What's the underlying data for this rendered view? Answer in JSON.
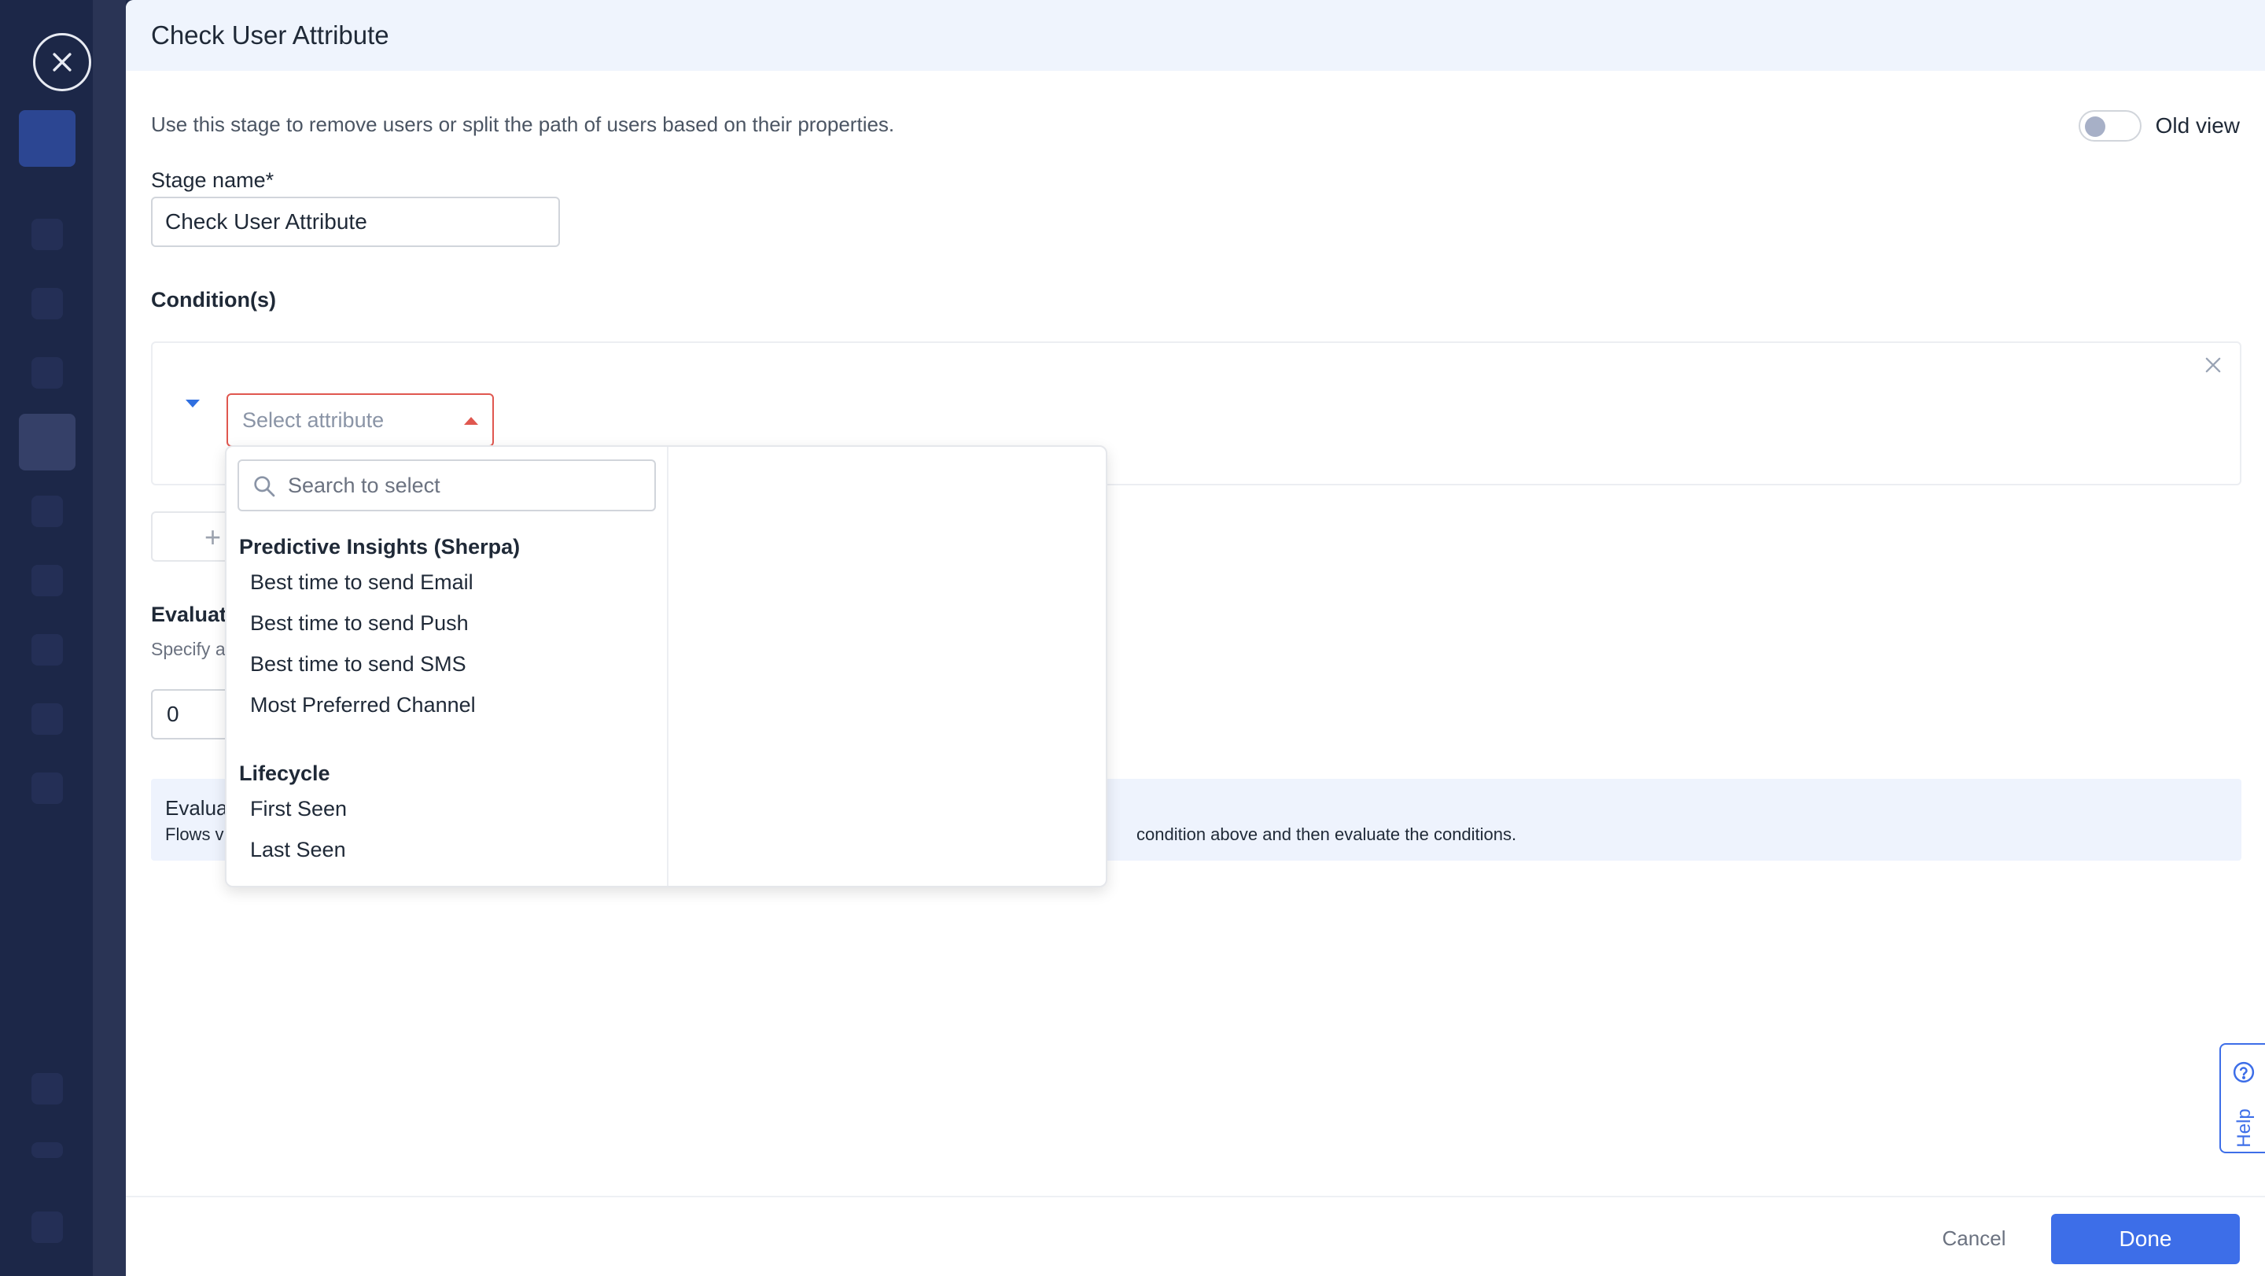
{
  "modal": {
    "title": "Check User Attribute",
    "description": "Use this stage to remove users or split the path of users based on their properties.",
    "old_view_label": "Old view",
    "stage_name_label": "Stage name*",
    "stage_name_value": "Check User Attribute",
    "conditions_label": "Condition(s)",
    "select_attribute_placeholder": "Select attribute",
    "add_condition_symbol": "+",
    "evaluate_title_partial": "Evaluat",
    "evaluate_sub_partial": "Specify a",
    "evaluate_value": "0",
    "info_title_partial": "Evalua",
    "info_text_partial": "Flows v",
    "info_text_tail": "condition above and then evaluate the conditions."
  },
  "dropdown": {
    "search_placeholder": "Search to select",
    "groups": [
      {
        "heading": "Predictive Insights (Sherpa)",
        "options": [
          "Best time to send Email",
          "Best time to send Push",
          "Best time to send SMS",
          "Most Preferred Channel"
        ]
      },
      {
        "heading": "Lifecycle",
        "options": [
          "First Seen",
          "Last Seen"
        ]
      }
    ]
  },
  "footer": {
    "cancel_label": "Cancel",
    "done_label": "Done"
  },
  "help": {
    "label": "Help"
  },
  "colors": {
    "primary": "#3d6ee8",
    "error": "#e0574f",
    "sidebar": "#1c2748",
    "header_bg": "#eff4fd"
  },
  "icons": [
    "close-circle-icon",
    "close-icon",
    "caret-down-icon",
    "caret-up-icon",
    "search-icon",
    "help-icon",
    "plus-icon"
  ]
}
